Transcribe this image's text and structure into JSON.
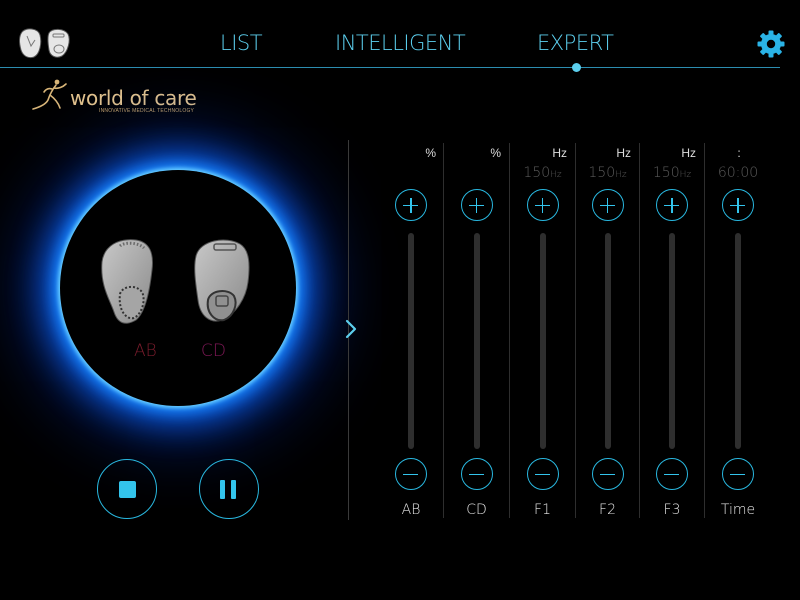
{
  "nav": {
    "tabs": [
      {
        "label": "LIST"
      },
      {
        "label": "INTELLIGENT"
      },
      {
        "label": "EXPERT",
        "active": true
      }
    ]
  },
  "logo": {
    "title": "world of care",
    "subtitle": "INNOVATIVE MEDICAL TECHNOLOGY"
  },
  "device": {
    "labels": [
      "AB",
      "CD"
    ]
  },
  "controls": {
    "stop_icon": "stop-icon",
    "pause_icon": "pause-icon"
  },
  "sliders": [
    {
      "unit": "%",
      "value": "",
      "label": "AB"
    },
    {
      "unit": "%",
      "value": "",
      "label": "CD"
    },
    {
      "unit": "Hz",
      "value": "150",
      "value_unit": "Hz",
      "label": "F1"
    },
    {
      "unit": "Hz",
      "value": "150",
      "value_unit": "Hz",
      "label": "F2"
    },
    {
      "unit": "Hz",
      "value": "150",
      "value_unit": "Hz",
      "label": "F3"
    },
    {
      "unit": ":",
      "value": "60:00",
      "value_unit": "",
      "label": "Time"
    }
  ],
  "colors": {
    "accent": "#33c4ec",
    "nav_text": "#5ccfee",
    "logo_gold": "#e4c48d",
    "label_ab": "#7a1c2c",
    "label_cd": "#7e1856",
    "glow": "#0c5ee6"
  },
  "icons": [
    "settings-gear-icon",
    "earbud-device-icon",
    "chevron-right-icon",
    "plus-icon",
    "minus-icon"
  ]
}
